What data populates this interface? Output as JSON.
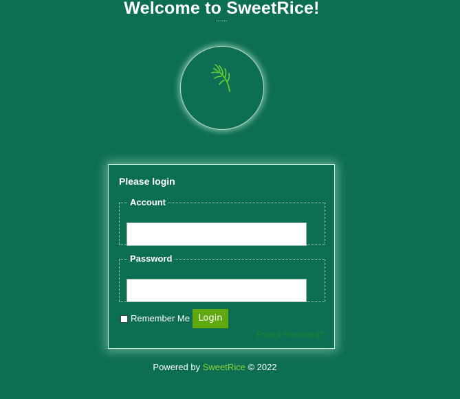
{
  "header": {
    "title": "Welcome to SweetRice!",
    "subtitle": "......",
    "logo_icon": "rice-sprout-icon"
  },
  "login": {
    "heading": "Please login",
    "account": {
      "legend": "Account",
      "value": "",
      "placeholder": ""
    },
    "password": {
      "legend": "Password",
      "value": "",
      "placeholder": ""
    },
    "remember_label": "Remember Me",
    "remember_checked": false,
    "login_button": "Login",
    "forgot_link": "Forgot Password?"
  },
  "footer": {
    "powered_by": "Powered by",
    "link_text": "SweetRice",
    "copyright": "© 2022"
  },
  "colors": {
    "background": "#0c6e52",
    "button": "#60a810",
    "link": "#8ed13f",
    "forgot_link": "#1c8a2a"
  }
}
